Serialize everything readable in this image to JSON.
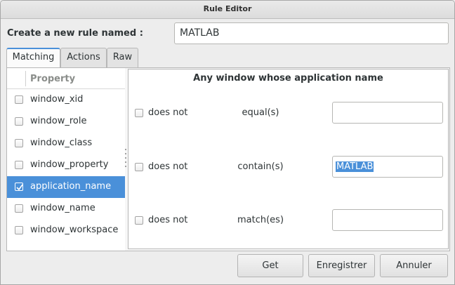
{
  "window": {
    "title": "Rule Editor"
  },
  "rule_name": {
    "label": "Create a new rule named :",
    "value": "MATLAB"
  },
  "tabs": [
    {
      "label": "Matching",
      "active": true
    },
    {
      "label": "Actions",
      "active": false
    },
    {
      "label": "Raw",
      "active": false
    }
  ],
  "properties": {
    "header": "Property",
    "items": [
      {
        "label": "window_xid",
        "checked": false,
        "selected": false
      },
      {
        "label": "window_role",
        "checked": false,
        "selected": false
      },
      {
        "label": "window_class",
        "checked": false,
        "selected": false
      },
      {
        "label": "window_property",
        "checked": false,
        "selected": false
      },
      {
        "label": "application_name",
        "checked": true,
        "selected": true
      },
      {
        "label": "window_name",
        "checked": false,
        "selected": false
      },
      {
        "label": "window_workspace",
        "checked": false,
        "selected": false
      }
    ]
  },
  "rule": {
    "title": "Any window whose application name",
    "rows": [
      {
        "negate_label": "does not",
        "negate_checked": false,
        "operator": "equal(s)",
        "value": ""
      },
      {
        "negate_label": "does not",
        "negate_checked": false,
        "operator": "contain(s)",
        "value": "MATLAB",
        "value_selected": true
      },
      {
        "negate_label": "does not",
        "negate_checked": false,
        "operator": "match(es)",
        "value": ""
      }
    ]
  },
  "buttons": {
    "get": "Get",
    "save": "Enregistrer",
    "cancel": "Annuler"
  },
  "colors": {
    "accent": "#4a90d9",
    "background": "#ededed"
  }
}
